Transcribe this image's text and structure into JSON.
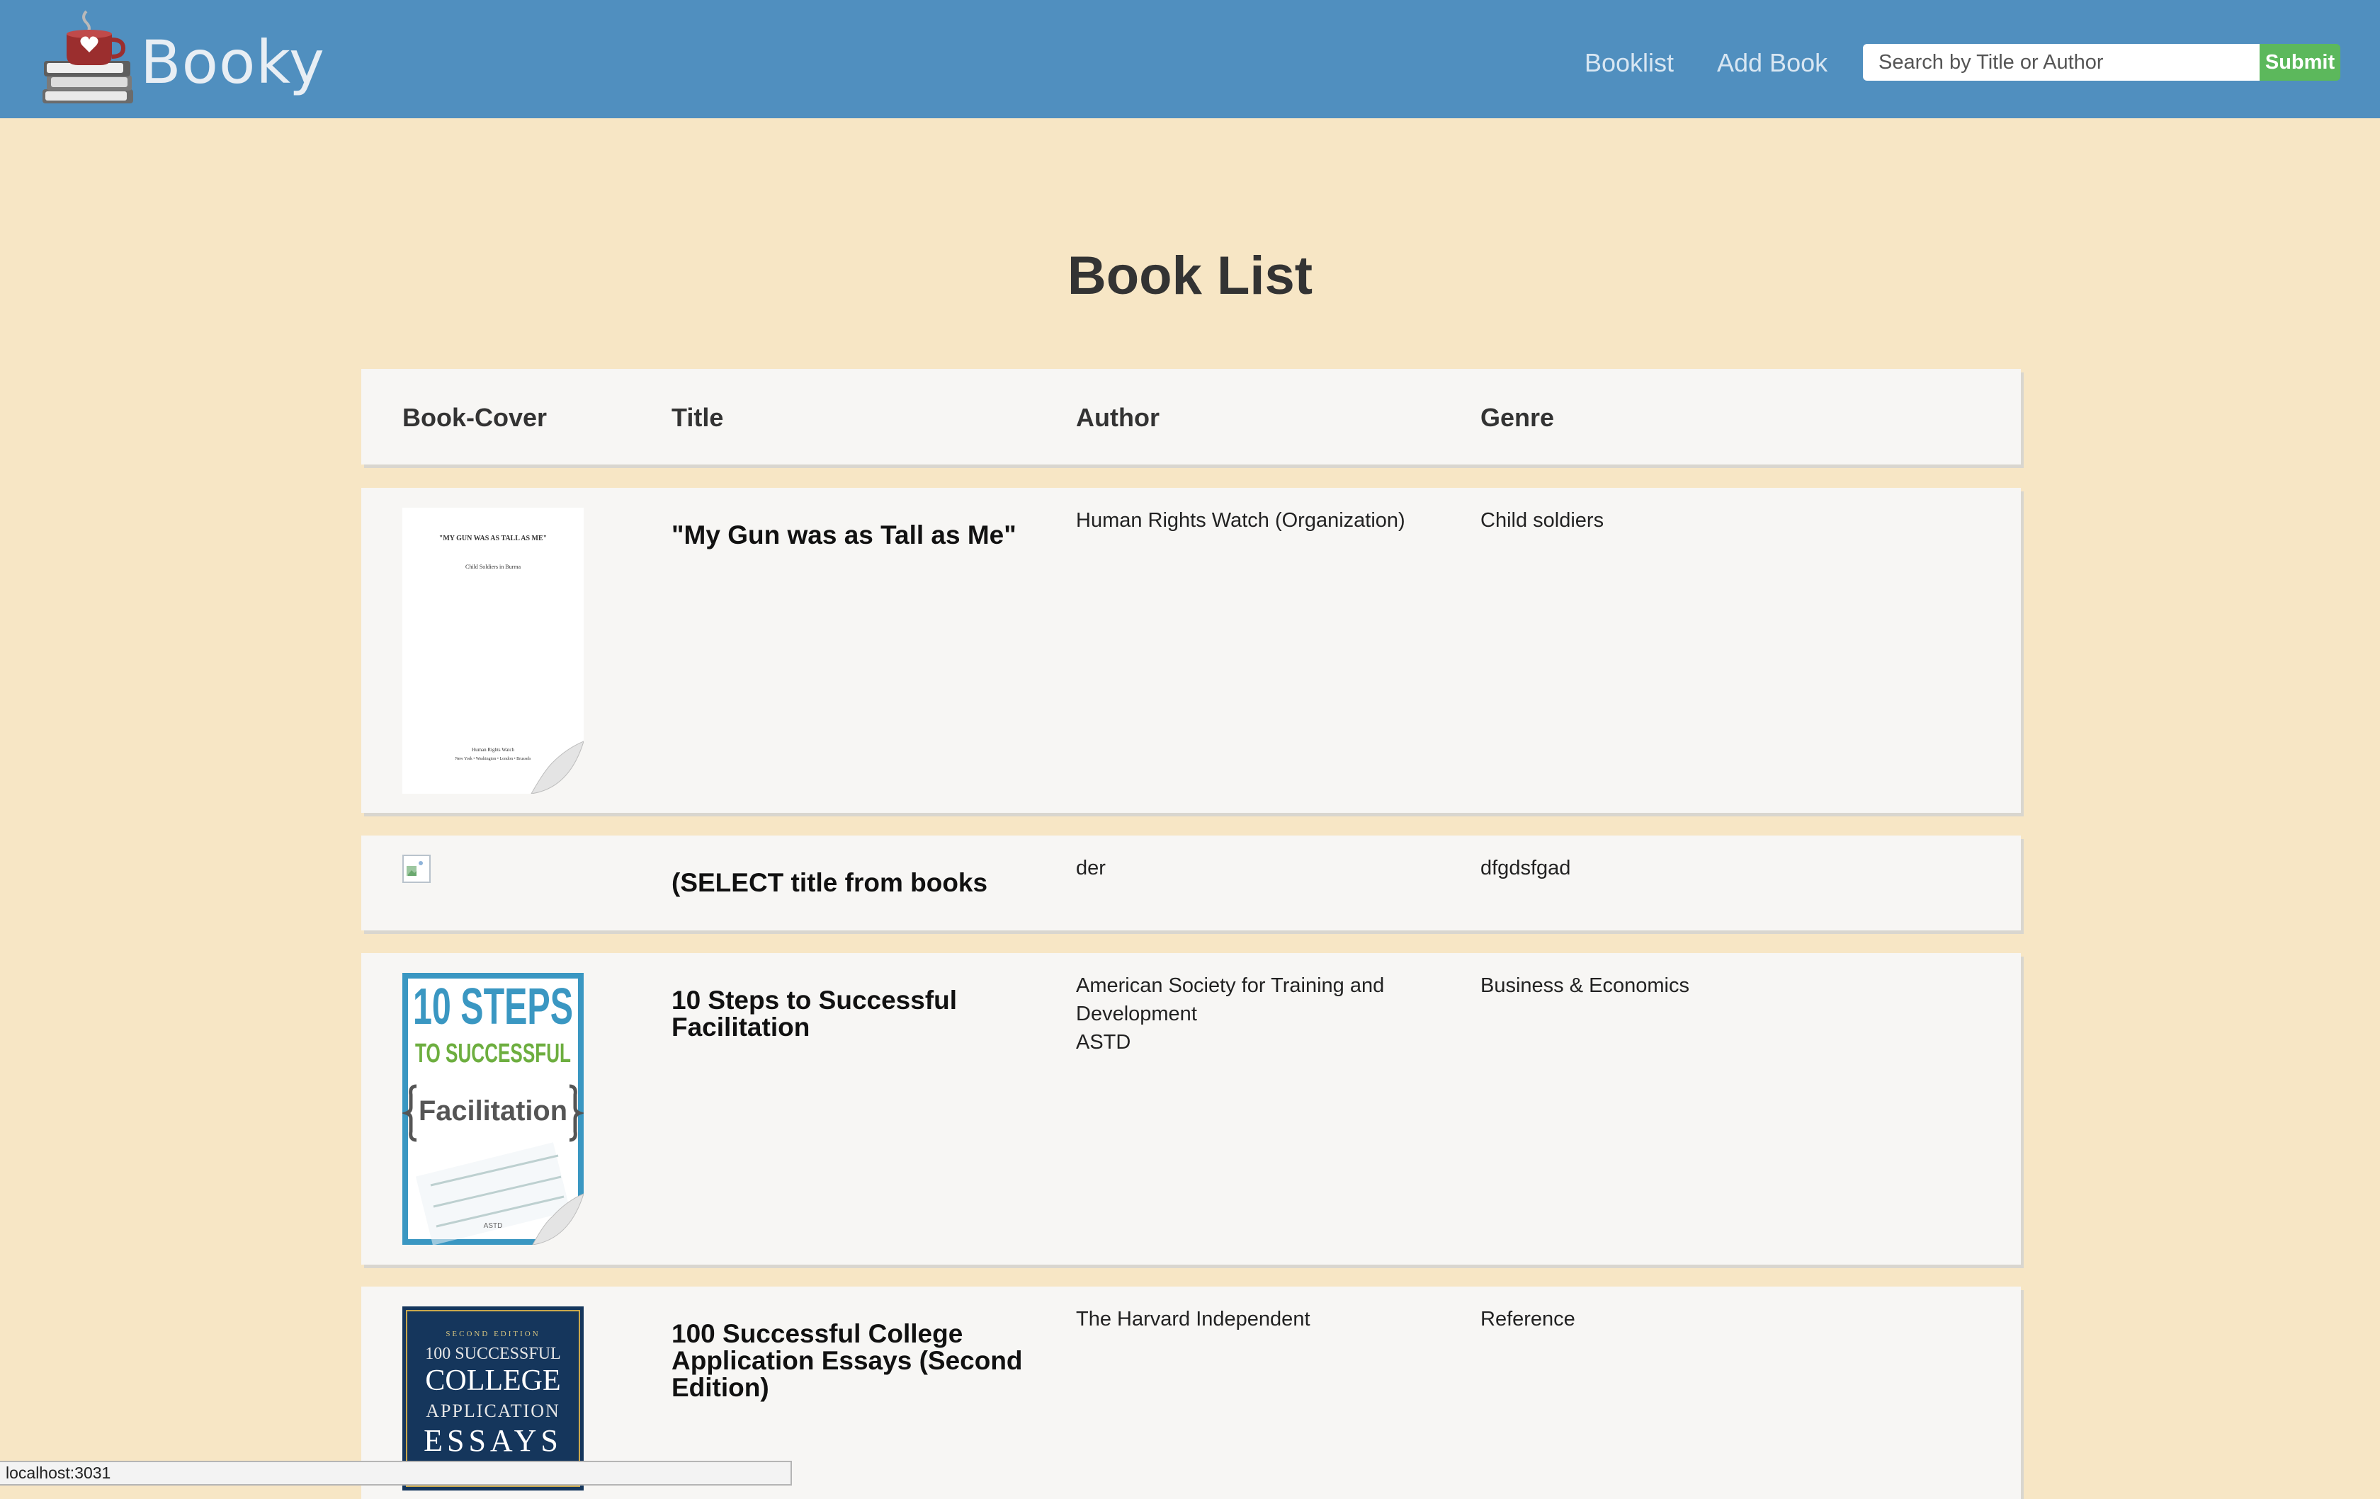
{
  "header": {
    "brand": "Booky",
    "nav": {
      "booklist": "Booklist",
      "add_book": "Add Book"
    },
    "search": {
      "placeholder": "Search by Title or Author",
      "value": ""
    },
    "submit_label": "Submit",
    "colors": {
      "navbar": "#508fbf",
      "submit": "#5cb85c"
    }
  },
  "main": {
    "title": "Book List",
    "columns": {
      "cover": "Book-Cover",
      "title": "Title",
      "author": "Author",
      "genre": "Genre"
    },
    "books": [
      {
        "title": "\"My Gun was as Tall as Me\"",
        "authors": [
          "Human Rights Watch (Organization)"
        ],
        "genre": "Child soldiers",
        "cover": {
          "text_top": "\"MY GUN WAS AS TALL AS ME\"",
          "text_sub": "Child Soldiers in Burma",
          "text_bottom": "Human Rights Watch",
          "text_cities": "New York • Washington • London • Brussels"
        }
      },
      {
        "title": "(SELECT title from books",
        "authors": [
          "der"
        ],
        "genre": "dfgdsfgad",
        "cover": null
      },
      {
        "title": "10 Steps to Successful Facilitation",
        "authors": [
          "American Society for Training and Development",
          "ASTD"
        ],
        "genre": "Business & Economics",
        "cover": {
          "line1": "10 STEPS",
          "line2": "TO SUCCESSFUL",
          "line3": "Facilitation",
          "publisher": "ASTD"
        }
      },
      {
        "title": "100 Successful College Application Essays (Second Edition)",
        "authors": [
          "The Harvard Independent"
        ],
        "genre": "Reference",
        "cover": {
          "edition": "SECOND EDITION",
          "line1": "100 SUCCESSFUL",
          "line2": "COLLEGE",
          "line3": "APPLICATION",
          "line4": "ESSAYS"
        }
      }
    ]
  },
  "statusbar": {
    "url": "localhost:3031"
  }
}
